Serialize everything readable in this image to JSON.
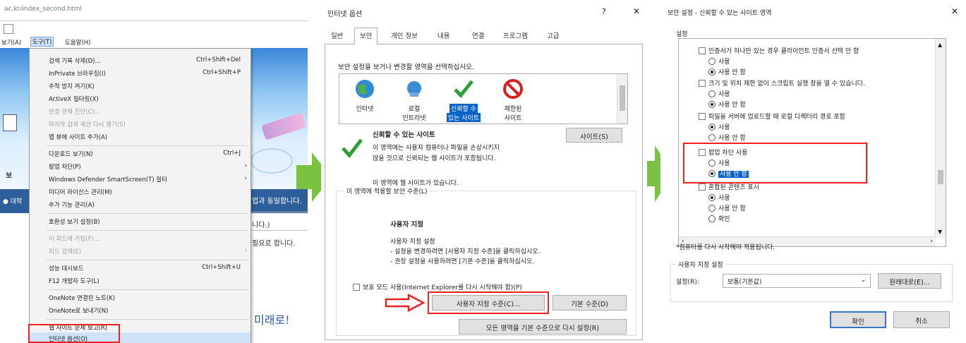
{
  "browser": {
    "address": "ac.kr/index_second.html",
    "menubar": {
      "view": "보기(A)",
      "tools": "도구(T)",
      "help": "도움말(H)"
    },
    "menu_items": [
      {
        "label": "검색 기록 삭제(D)...",
        "shortcut": "Ctrl+Shift+Del"
      },
      {
        "label": "InPrivate 브라우징(I)",
        "shortcut": "Ctrl+Shift+P"
      },
      {
        "label": "추적 방지 켜기(K)",
        "shortcut": ""
      },
      {
        "label": "ActiveX 필터링(X)",
        "shortcut": ""
      },
      {
        "label": "연결 문제 진단(C)...",
        "shortcut": "",
        "disabled": true
      },
      {
        "label": "마지막 검색 세션 다시 열기(S)",
        "shortcut": "",
        "disabled": true
      },
      {
        "label": "앱 뷰에 사이트 추가(A)",
        "shortcut": ""
      },
      {
        "label": "다운로드 보기(N)",
        "shortcut": "Ctrl+J"
      },
      {
        "label": "팝업 차단(P)",
        "shortcut": "",
        "submenu": true
      },
      {
        "label": "Windows Defender SmartScreen(T) 필터",
        "shortcut": "",
        "submenu": true
      },
      {
        "label": "미디어 라이선스 관리(M)",
        "shortcut": ""
      },
      {
        "label": "추가 기능 관리(A)",
        "shortcut": ""
      },
      {
        "label": "호환성 보기 설정(B)",
        "shortcut": ""
      },
      {
        "label": "이 피드에 가입(F)...",
        "shortcut": "",
        "disabled": true
      },
      {
        "label": "피드 검색(E)",
        "shortcut": "",
        "disabled": true,
        "submenu": true
      },
      {
        "label": "성능 대시보드",
        "shortcut": "Ctrl+Shift+U"
      },
      {
        "label": "F12 개발자 도구(L)",
        "shortcut": ""
      },
      {
        "label": "OneNote 연결된 노트(K)",
        "shortcut": ""
      },
      {
        "label": "OneNote로 보내기(N)",
        "shortcut": ""
      },
      {
        "label": "웹 사이트 문제 보고(R)",
        "shortcut": ""
      },
      {
        "label": "인터넷 옵션(O)",
        "shortcut": ""
      }
    ],
    "page_text": {
      "side_a": "보",
      "link_a": "● 대학",
      "line1": "업과 동일합니다.",
      "line2": "니다.)",
      "line3": "필요로 합니다.",
      "slogan": "미래로!"
    }
  },
  "internet_options": {
    "title": "인터넷 옵션",
    "help": "?",
    "close": "✕",
    "tabs": [
      "일반",
      "보안",
      "개인 정보",
      "내용",
      "연결",
      "프로그램",
      "고급"
    ],
    "active_tab": 1,
    "zone_prompt": "보안 설정을 보거나 변경할 영역을 선택하십시오.",
    "zones": [
      {
        "label_1": "인터넷",
        "label_2": ""
      },
      {
        "label_1": "로컬",
        "label_2": "인트라넷"
      },
      {
        "label_1": "신뢰할 수",
        "label_2": "있는 사이트"
      },
      {
        "label_1": "제한된",
        "label_2": "사이트"
      }
    ],
    "zone_name": "신뢰할 수 있는 사이트",
    "zone_desc_1": "이 영역에는 사용자 컴퓨터나 파일을 손상시키지",
    "zone_desc_2": "않을 것으로 신뢰되는 웹 사이트가 포함됩니다.",
    "zone_note": "이 영역에 웹 사이트가 있습니다.",
    "sites_button": "사이트(S)",
    "level_group": "이 영역에 적용할 보안 수준(L)",
    "custom_title": "사용자 지정",
    "custom_desc_1": "사용자 지정 설정",
    "custom_desc_2": "- 설정을 변경하려면 [사용자 지정 수준]을 클릭하십시오.",
    "custom_desc_3": "- 권장 설정을 사용하려면 [기본 수준]을 클릭하십시오.",
    "protected_mode": "보호 모드 사용(Internet Explorer를 다시 시작해야 함)(P)",
    "custom_level_button": "사용자 지정 수준(C)...",
    "default_level_button": "기본 수준(D)",
    "reset_all_button": "모든 영역을 기본 수준으로 다시 설정(R)"
  },
  "security_settings": {
    "title": "보안 설정 - 신뢰할 수 있는 사이트 영역",
    "close": "✕",
    "group": "설정",
    "items": [
      {
        "type": "check",
        "label": "인증서가 하나만 있는 경우 클라이언트 인증서 선택 안 함"
      },
      {
        "type": "radio",
        "label": "사용",
        "checked": false
      },
      {
        "type": "radio",
        "label": "사용 안 함",
        "checked": true
      },
      {
        "type": "check",
        "label": "크기 및 위치 제한 없이 스크립트 실행 창을 열 수 있습니다."
      },
      {
        "type": "radio",
        "label": "사용",
        "checked": false
      },
      {
        "type": "radio",
        "label": "사용 안 함",
        "checked": true
      },
      {
        "type": "check",
        "label": "파일을 서버에 업로드할 때 로컬 디렉터리 경로 포함"
      },
      {
        "type": "radio",
        "label": "사용",
        "checked": true
      },
      {
        "type": "radio",
        "label": "사용 안 함",
        "checked": false
      },
      {
        "type": "check",
        "label": "팝업 차단 사용"
      },
      {
        "type": "radio",
        "label": "사용",
        "checked": false
      },
      {
        "type": "radio",
        "label": "사용 안 함",
        "checked": true,
        "selected": true
      },
      {
        "type": "check",
        "label": "혼합된 콘텐츠 표시"
      },
      {
        "type": "radio",
        "label": "사용",
        "checked": true
      },
      {
        "type": "radio",
        "label": "사용 안 함",
        "checked": false
      },
      {
        "type": "radio",
        "label": "확인",
        "checked": false
      }
    ],
    "restart_note": "*컴퓨터를 다시 시작해야 적용됩니다.",
    "reset_group": "사용자 지정 설정",
    "reset_label": "설정(R):",
    "reset_value": "보통(기본값)",
    "reset_button": "원래대로(E)...",
    "ok": "확인",
    "cancel": "취소"
  },
  "colors": {
    "highlight": "#0b63c7",
    "red": "#e22222",
    "green_arrow": "#7cc241"
  }
}
